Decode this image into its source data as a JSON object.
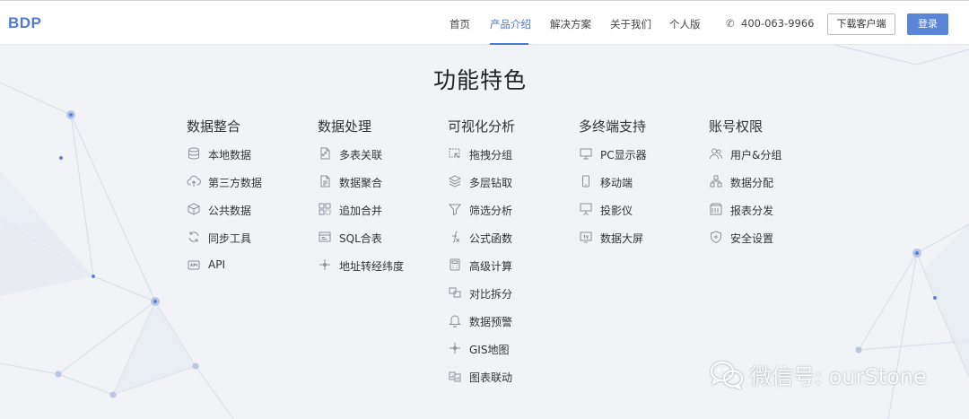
{
  "logo": "BDP",
  "nav": {
    "items": [
      "首页",
      "产品介绍",
      "解决方案",
      "关于我们",
      "个人版"
    ],
    "active": "产品介绍"
  },
  "phone": "400-063-9966",
  "buttons": {
    "download": "下载客户端",
    "login": "登录"
  },
  "title": "功能特色",
  "columns": [
    {
      "heading": "数据整合",
      "items": [
        {
          "label": "本地数据",
          "icon": "database-icon"
        },
        {
          "label": "第三方数据",
          "icon": "cloud-upload-icon"
        },
        {
          "label": "公共数据",
          "icon": "cube-icon"
        },
        {
          "label": "同步工具",
          "icon": "sync-icon"
        },
        {
          "label": "API",
          "icon": "api-icon"
        }
      ]
    },
    {
      "heading": "数据处理",
      "items": [
        {
          "label": "多表关联",
          "icon": "link-doc-icon"
        },
        {
          "label": "数据聚合",
          "icon": "document-icon"
        },
        {
          "label": "追加合并",
          "icon": "merge-icon"
        },
        {
          "label": "SQL合表",
          "icon": "sql-icon"
        },
        {
          "label": "地址转经纬度",
          "icon": "crosshair-icon"
        }
      ]
    },
    {
      "heading": "可视化分析",
      "items": [
        {
          "label": "拖拽分组",
          "icon": "drag-icon"
        },
        {
          "label": "多层钻取",
          "icon": "layers-icon"
        },
        {
          "label": "筛选分析",
          "icon": "filter-icon"
        },
        {
          "label": "公式函数",
          "icon": "function-icon"
        },
        {
          "label": "高级计算",
          "icon": "calculator-icon"
        },
        {
          "label": "对比拆分",
          "icon": "compare-icon"
        },
        {
          "label": "数据预警",
          "icon": "bell-icon"
        },
        {
          "label": "GIS地图",
          "icon": "crosshair-icon"
        },
        {
          "label": "图表联动",
          "icon": "chart-link-icon"
        }
      ]
    },
    {
      "heading": "多终端支持",
      "items": [
        {
          "label": "PC显示器",
          "icon": "monitor-icon"
        },
        {
          "label": "移动端",
          "icon": "mobile-icon"
        },
        {
          "label": "投影仪",
          "icon": "projector-icon"
        },
        {
          "label": "数据大屏",
          "icon": "tv-icon"
        }
      ]
    },
    {
      "heading": "账号权限",
      "items": [
        {
          "label": "用户&分组",
          "icon": "users-icon"
        },
        {
          "label": "数据分配",
          "icon": "hierarchy-icon"
        },
        {
          "label": "报表分发",
          "icon": "report-icon"
        },
        {
          "label": "安全设置",
          "icon": "shield-icon"
        }
      ]
    }
  ],
  "watermark": "微信号: ourStone"
}
